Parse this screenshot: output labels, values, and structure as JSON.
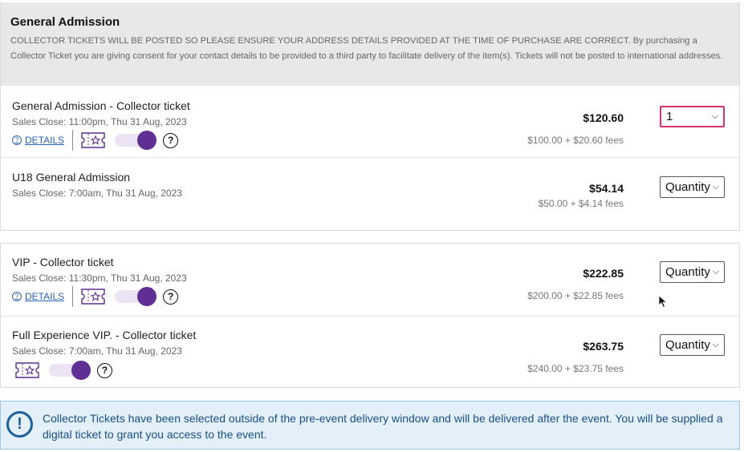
{
  "section": {
    "title": "General Admission",
    "notice": "COLLECTOR TICKETS WILL BE POSTED SO PLEASE ENSURE YOUR ADDRESS DETAILS PROVIDED AT THE TIME OF PURCHASE ARE CORRECT. By purchasing a Collector Ticket you are giving consent for your contact details to be provided to a third party to facilitate delivery of the item(s). Tickets will not be posted to international addresses."
  },
  "tickets": [
    {
      "name": "General Admission - Collector ticket",
      "sales_close": "Sales Close: 11:00pm, Thu 31 Aug, 2023",
      "price": "$120.60",
      "fees": "$100.00 + $20.60 fees",
      "quantity": "1",
      "details_label": "DETAILS",
      "collector_toggle": true
    },
    {
      "name": "U18 General Admission",
      "sales_close": "Sales Close: 7:00am, Thu 31 Aug, 2023",
      "price": "$54.14",
      "fees": "$50.00 + $4.14 fees",
      "quantity": "Quantity"
    },
    {
      "name": "VIP - Collector ticket",
      "sales_close": "Sales Close: 11:30pm, Thu 31 Aug, 2023",
      "price": "$222.85",
      "fees": "$200.00 + $22.85 fees",
      "quantity": "Quantity",
      "details_label": "DETAILS",
      "collector_toggle": true
    },
    {
      "name": "Full Experience VIP. - Collector ticket",
      "sales_close": "Sales Close: 7:00am, Thu 31 Aug, 2023",
      "price": "$263.75",
      "fees": "$240.00 + $23.75 fees",
      "quantity": "Quantity",
      "collector_toggle": true
    }
  ],
  "alert": {
    "message": "Collector Tickets have been selected outside of the pre-event delivery window and will be delivered after the event. You will be supplied a digital ticket to grant you access to the event."
  },
  "colors": {
    "accent_purple": "#5f2f93",
    "selected_border": "#d6336c",
    "link_blue": "#2a62b5",
    "alert_bg": "#e3f0f9"
  }
}
